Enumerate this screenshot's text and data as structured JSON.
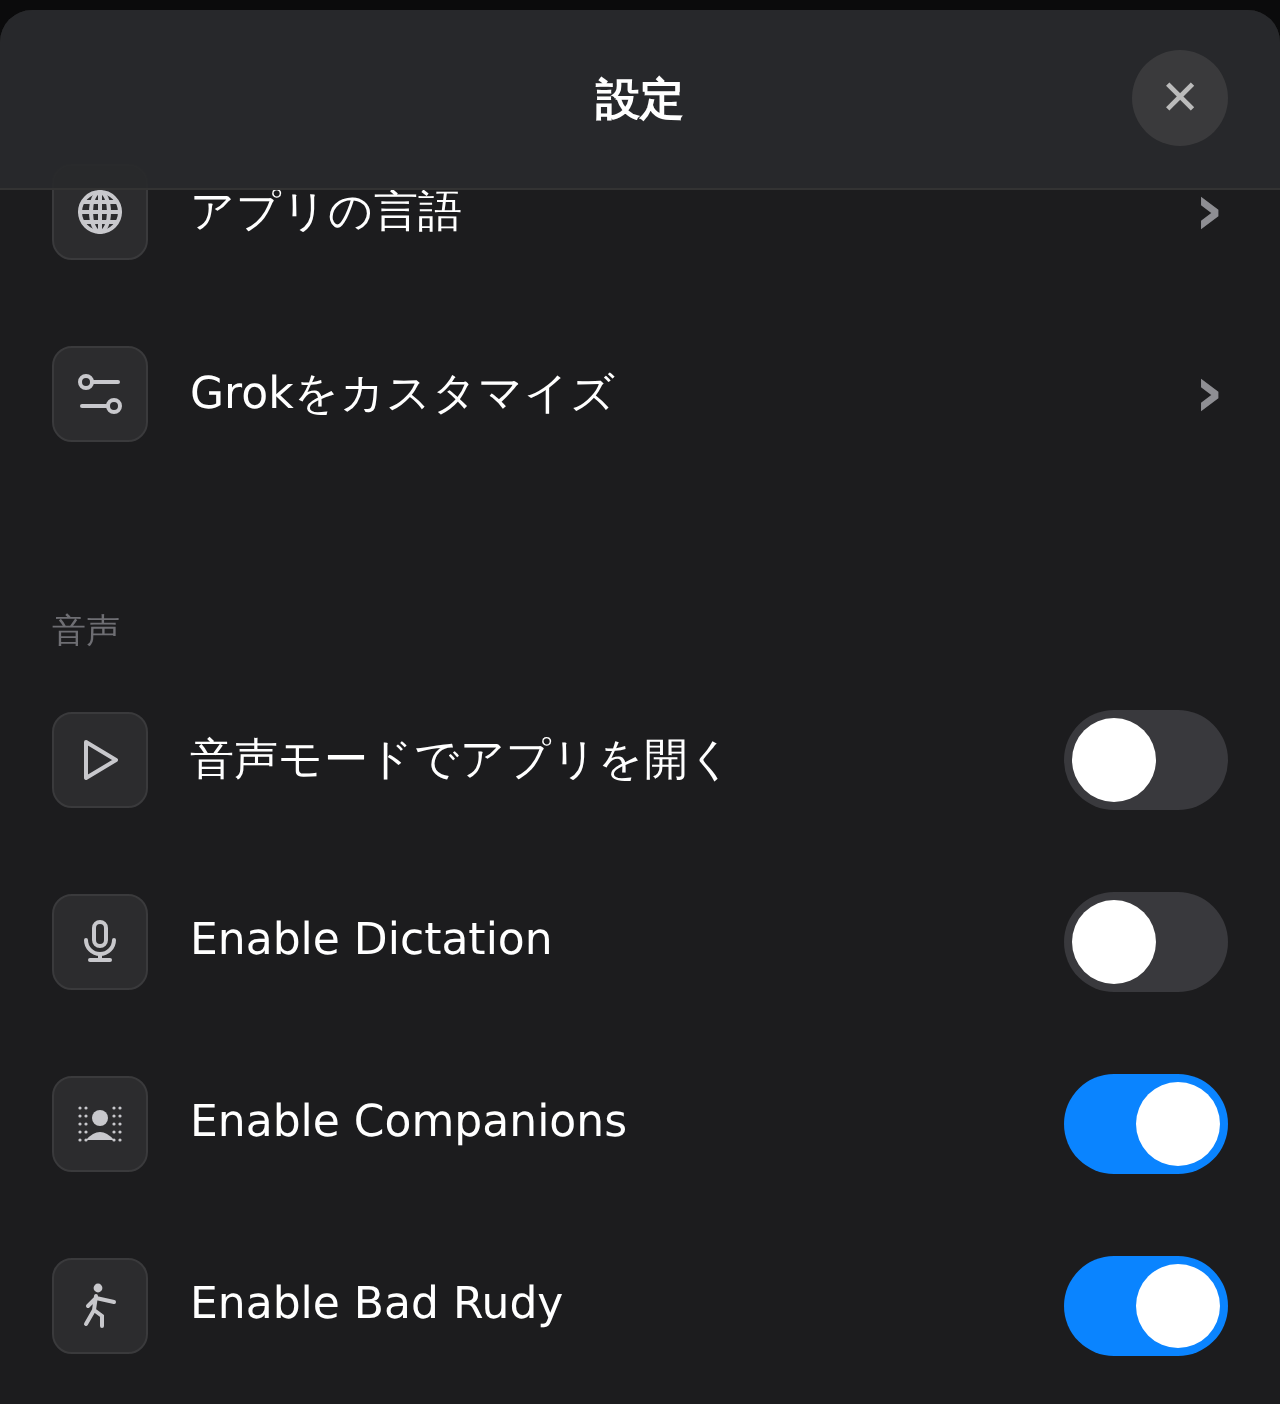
{
  "header": {
    "title": "設定",
    "close": "✕"
  },
  "sections": [
    {
      "rows": [
        {
          "kind": "link",
          "label": "アプリの言語",
          "chevron": "›"
        },
        {
          "kind": "link",
          "label": "Grokをカスタマイズ",
          "chevron": "›"
        }
      ]
    },
    {
      "title": "音声",
      "rows": [
        {
          "kind": "toggle",
          "label": "音声モードでアプリを開く",
          "on": false
        },
        {
          "kind": "toggle",
          "label": "Enable Dictation",
          "on": false
        },
        {
          "kind": "toggle",
          "label": "Enable Companions",
          "on": true
        },
        {
          "kind": "toggle",
          "label": "Enable Bad Rudy",
          "on": true
        }
      ]
    }
  ]
}
